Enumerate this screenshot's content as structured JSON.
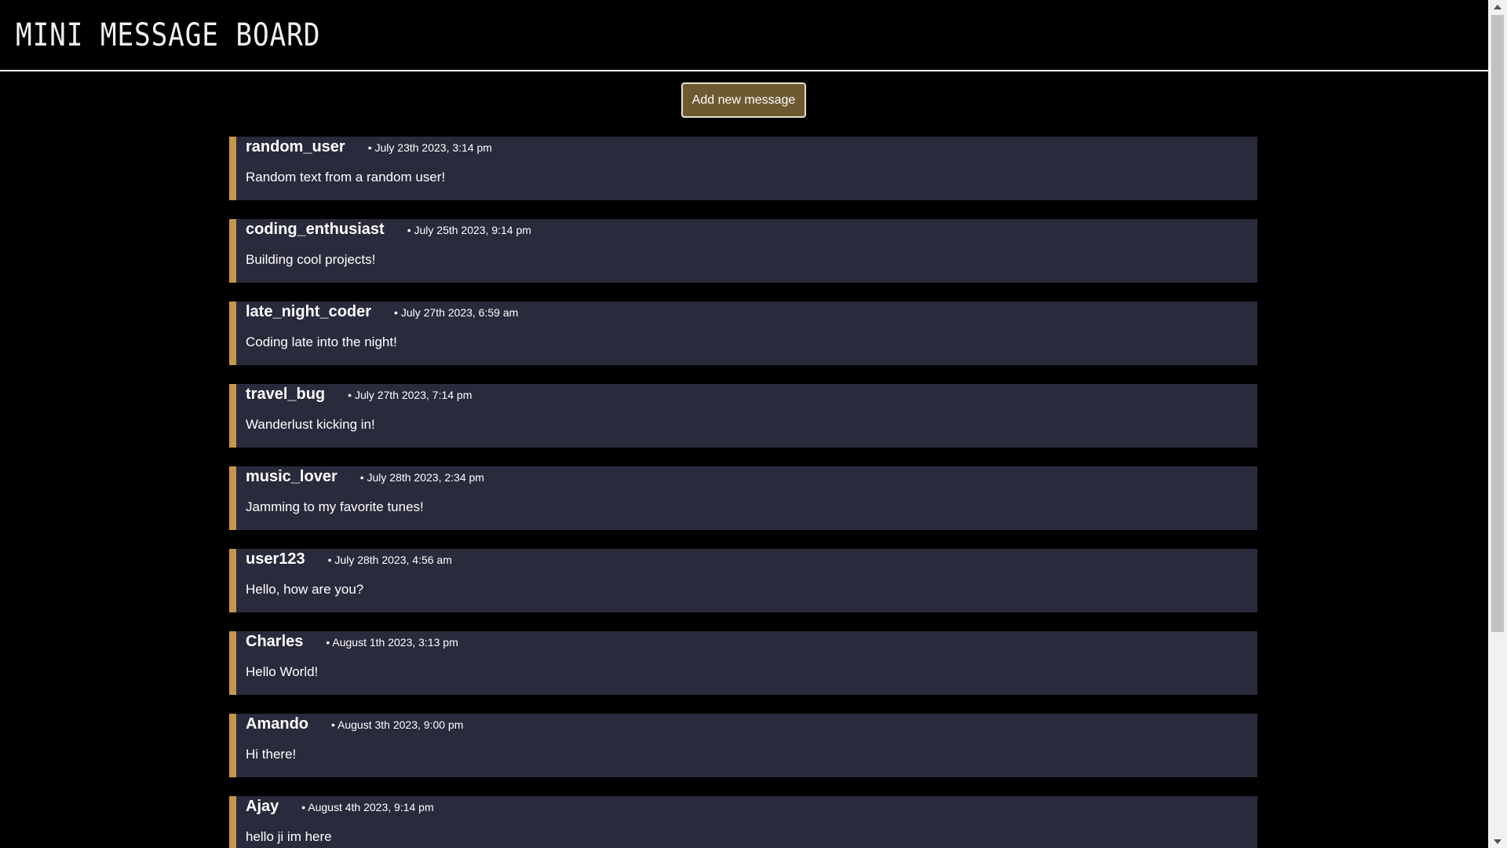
{
  "header": {
    "title": "MINI MESSAGE BOARD"
  },
  "actions": {
    "add_label": "Add new message"
  },
  "messages": [
    {
      "user": "random_user",
      "time": "• July 23th 2023, 3:14 pm",
      "text": "Random text from a random user!"
    },
    {
      "user": "coding_enthusiast",
      "time": "• July 25th 2023, 9:14 pm",
      "text": "Building cool projects!"
    },
    {
      "user": "late_night_coder",
      "time": "• July 27th 2023, 6:59 am",
      "text": "Coding late into the night!"
    },
    {
      "user": "travel_bug",
      "time": "• July 27th 2023, 7:14 pm",
      "text": "Wanderlust kicking in!"
    },
    {
      "user": "music_lover",
      "time": "• July 28th 2023, 2:34 pm",
      "text": "Jamming to my favorite tunes!"
    },
    {
      "user": "user123",
      "time": "• July 28th 2023, 4:56 am",
      "text": "Hello, how are you?"
    },
    {
      "user": "Charles",
      "time": "• August 1th 2023, 3:13 pm",
      "text": "Hello World!"
    },
    {
      "user": "Amando",
      "time": "• August 3th 2023, 9:00 pm",
      "text": "Hi there!"
    },
    {
      "user": "Ajay",
      "time": "• August 4th 2023, 9:14 pm",
      "text": "hello ji im here"
    }
  ],
  "colors": {
    "background": "#000000",
    "card": "#292a3b",
    "accent": "#c4974a",
    "button": "#6e5a30"
  },
  "icons": {
    "scroll_up": "arrow-up-icon",
    "scroll_down": "arrow-down-icon"
  }
}
